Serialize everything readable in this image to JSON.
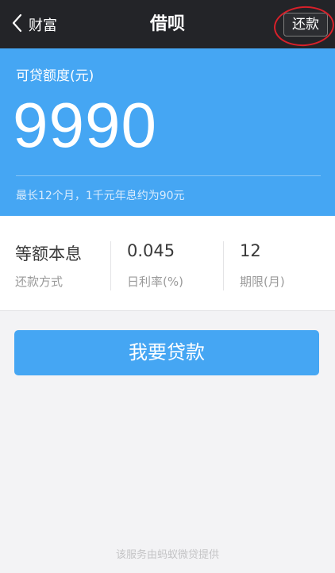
{
  "nav": {
    "back_label": "财富",
    "title": "借呗",
    "repay_label": "还款"
  },
  "credit": {
    "label": "可贷额度(元)",
    "amount": "9990",
    "note": "最长12个月，1千元年息约为90元"
  },
  "info": [
    {
      "value": "等额本息",
      "key": "还款方式"
    },
    {
      "value": "0.045",
      "key": "日利率(%)"
    },
    {
      "value": "12",
      "key": "期限(月)"
    }
  ],
  "loan_button_label": "我要贷款",
  "footer_note": "该服务由蚂蚁微贷提供",
  "colors": {
    "navbar": "#232428",
    "accent_blue": "#45a6f3",
    "highlight_red": "#d8202a"
  }
}
